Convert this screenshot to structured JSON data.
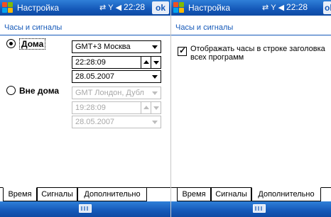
{
  "status": {
    "title": "Настройка",
    "time": "22:28",
    "ok_label": "ok"
  },
  "left": {
    "section_title": "Часы и сигналы",
    "home": {
      "label": "Дома",
      "selected": true,
      "timezone": "GMT+3 Москва",
      "time": "22:28:09",
      "date": "28.05.2007"
    },
    "away": {
      "label": "Вне дома",
      "selected": false,
      "timezone": "GMT Лондон, Дубл",
      "time": "19:28:09",
      "date": "28.05.2007"
    },
    "tabs": [
      {
        "label": "Время",
        "active": true
      },
      {
        "label": "Сигналы",
        "active": false
      },
      {
        "label": "Дополнительно",
        "active": false
      }
    ]
  },
  "right": {
    "section_title": "Часы и сигналы",
    "option": {
      "label": "Отображать часы в строке заголовка всех программ",
      "checked": true
    },
    "tabs": [
      {
        "label": "Время",
        "active": false
      },
      {
        "label": "Сигналы",
        "active": false
      },
      {
        "label": "Дополнительно",
        "active": true
      }
    ]
  },
  "icons": {
    "start": "windows-start-icon",
    "network": "network-sync-icon",
    "signal": "signal-strength-icon",
    "volume": "speaker-icon",
    "keyboard": "keyboard-icon"
  },
  "colors": {
    "titlebar": "#1458b8",
    "accent": "#1458b8",
    "disabled_text": "#a8a8a8"
  }
}
